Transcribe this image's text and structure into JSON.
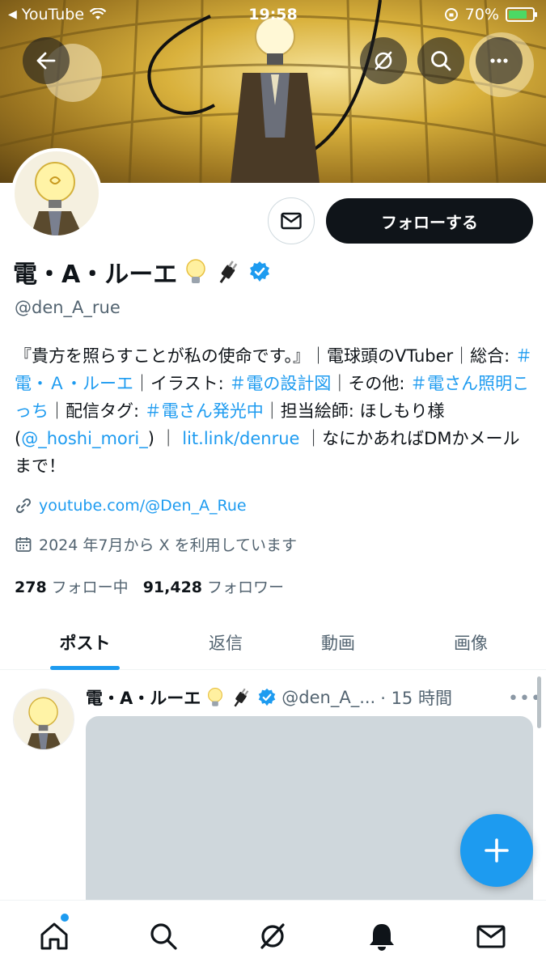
{
  "status_bar": {
    "back_app": "YouTube",
    "time": "19:58",
    "battery": "70%"
  },
  "profile": {
    "name": "電・A・ルーエ",
    "handle": "@den_A_rue",
    "follow_label": "フォローする",
    "bio": {
      "p1": "『貴方を照らすことが私の使命です。』｜電球頭のVTuber｜総合: ",
      "tag1": "＃電・Ａ・ルーエ",
      "p2": "｜イラスト: ",
      "tag2": "＃電の設計図",
      "p3": "｜その他: ",
      "tag3": "＃電さん照明こっち",
      "p4": "｜配信タグ: ",
      "tag4": "＃電さん発光中",
      "p5": "｜担当絵師: ほしもり様 (",
      "mention": "@_hoshi_mori_",
      "p6": ") ｜ ",
      "link": "lit.link/denrue",
      "p7": " ｜なにかあればDMかメールまで！"
    },
    "website": "youtube.com/@Den_A_Rue",
    "joined": "2024 年7月から X を利用しています",
    "following_count": "278",
    "following_label": "フォロー中",
    "followers_count": "91,428",
    "followers_label": "フォロワー"
  },
  "tabs": [
    {
      "label": "ポスト",
      "active": true
    },
    {
      "label": "返信"
    },
    {
      "label": "動画"
    },
    {
      "label": "画像"
    }
  ],
  "post": {
    "name": "電・A・ルーエ",
    "handle": "@den_A_...",
    "time": "· 15 時間"
  },
  "colors": {
    "accent": "#1d9bf0",
    "text": "#0f1419",
    "muted": "#536471",
    "follow_bg": "#0f1419"
  },
  "icons": [
    "back-arrow-icon",
    "grok-icon",
    "search-icon",
    "more-icon",
    "mail-icon",
    "verified-badge-icon",
    "link-icon",
    "calendar-icon",
    "plus-icon",
    "home-icon",
    "bell-icon"
  ]
}
